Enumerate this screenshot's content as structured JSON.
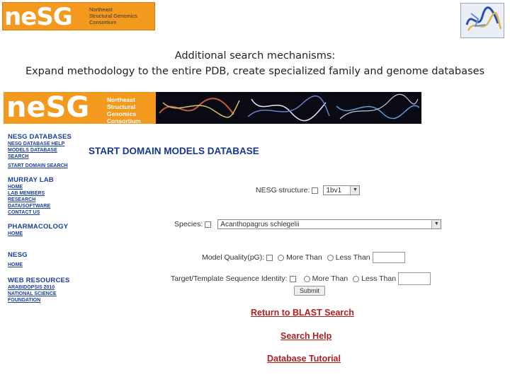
{
  "slide": {
    "logo": {
      "mark": "neSG",
      "tagline": [
        "Northeast",
        "Structural Genomics",
        "Consortium"
      ]
    },
    "subtitle_line1": "Additional search mechanisms:",
    "subtitle_line2": "Expand methodology to the entire PDB, create specialized family and genome databases"
  },
  "screenshot": {
    "banner": {
      "mark": "neSG",
      "tagline": [
        "Northeast",
        "Structural",
        "Genomics",
        "Consortium"
      ]
    },
    "sidebar": [
      {
        "title": "NESG DATABASES",
        "links": [
          "NESG DATABASE HELP",
          "MODELS DATABASE",
          "SEARCH",
          "START DOMAIN SEARCH"
        ]
      },
      {
        "title": "MURRAY LAB",
        "links": [
          "HOME",
          "LAB MEMBERS",
          "RESEARCH",
          "DATA/SOFTWARE",
          "CONTACT US"
        ]
      },
      {
        "title": "PHARMACOLOGY",
        "links": [
          "HOME"
        ]
      },
      {
        "title": "NESG",
        "links": [
          "HOME"
        ]
      },
      {
        "title": "WEB RESOURCES",
        "links": [
          "ARABIDOPSIS 2010",
          "NATIONAL SCIENCE",
          "FOUNDATION"
        ]
      }
    ],
    "main_title": "START DOMAIN MODELS DATABASE",
    "form": {
      "nesg_structure_label": "NESG structure:",
      "nesg_structure_value": "1bv1",
      "species_label": "Species:",
      "species_value": "Acanthopagrus schlegelii",
      "model_quality_label": "Model Quality(pG):",
      "more_than": "More Than",
      "less_than": "Less Than",
      "identity_label": "Target/Template Sequence Identity:",
      "submit": "Submit"
    },
    "links": [
      "Return to BLAST Search",
      "Search Help",
      "Database Tutorial"
    ]
  }
}
